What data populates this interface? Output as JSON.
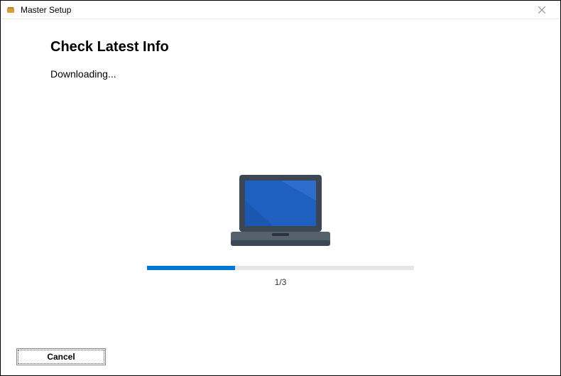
{
  "titlebar": {
    "title": "Master Setup"
  },
  "page": {
    "heading": "Check Latest Info",
    "status": "Downloading..."
  },
  "progress": {
    "percent": 33,
    "label": "1/3"
  },
  "footer": {
    "cancel_label": "Cancel"
  },
  "colors": {
    "accent": "#0078d7"
  }
}
